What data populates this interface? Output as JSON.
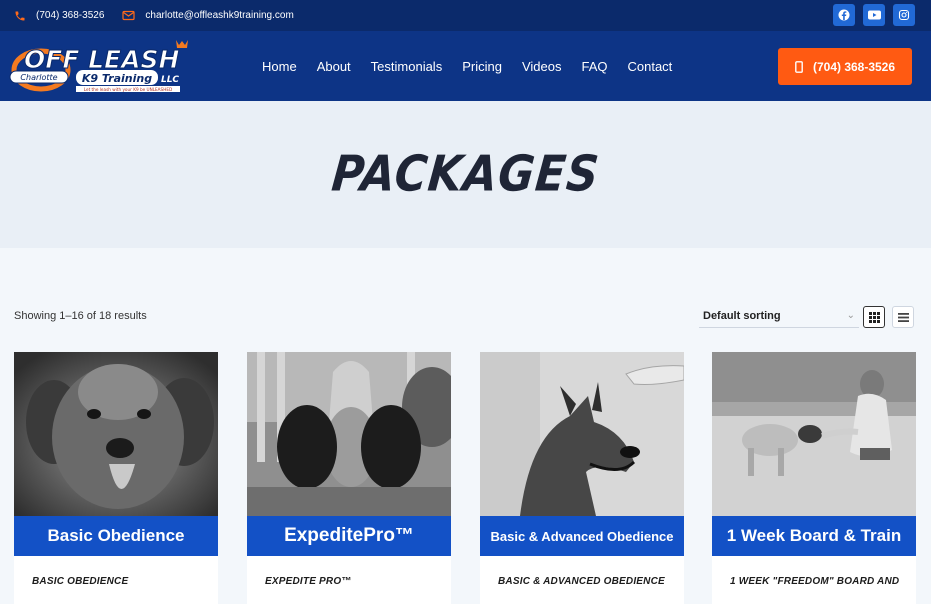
{
  "topbar": {
    "phone": "(704) 368-3526",
    "email": "charlotte@offleashk9training.com",
    "socials": [
      "facebook-icon",
      "youtube-icon",
      "instagram-icon"
    ]
  },
  "brand": {
    "logo_main": "OFF LEASH",
    "logo_city": "Charlotte",
    "logo_sub": "K9 Training",
    "logo_llc": "LLC",
    "logo_tagline": "Let the leash with your K9 be UNLEASHED"
  },
  "nav": {
    "items": [
      "Home",
      "About",
      "Testimonials",
      "Pricing",
      "Videos",
      "FAQ",
      "Contact"
    ]
  },
  "cta": {
    "label": "(704) 368-3526"
  },
  "hero": {
    "title": "PACKAGES"
  },
  "shop": {
    "results": "Showing 1–16 of 18 results",
    "sorting": "Default sorting"
  },
  "products": [
    {
      "banner": "Basic Obedience",
      "title": "BASIC OBEDIENCE"
    },
    {
      "banner": "ExpeditePro™",
      "title": "EXPEDITE PRO™"
    },
    {
      "banner": "Basic & Advanced Obedience",
      "title": "BASIC & ADVANCED OBEDIENCE"
    },
    {
      "banner": "1 Week Board & Train",
      "title": "1 WEEK \"FREEDOM\" BOARD AND"
    }
  ],
  "colors": {
    "topbar": "#0b2a6b",
    "header": "#0d3486",
    "cta": "#ff5a12",
    "banner": "#1351c6",
    "social": "#2169d6"
  }
}
